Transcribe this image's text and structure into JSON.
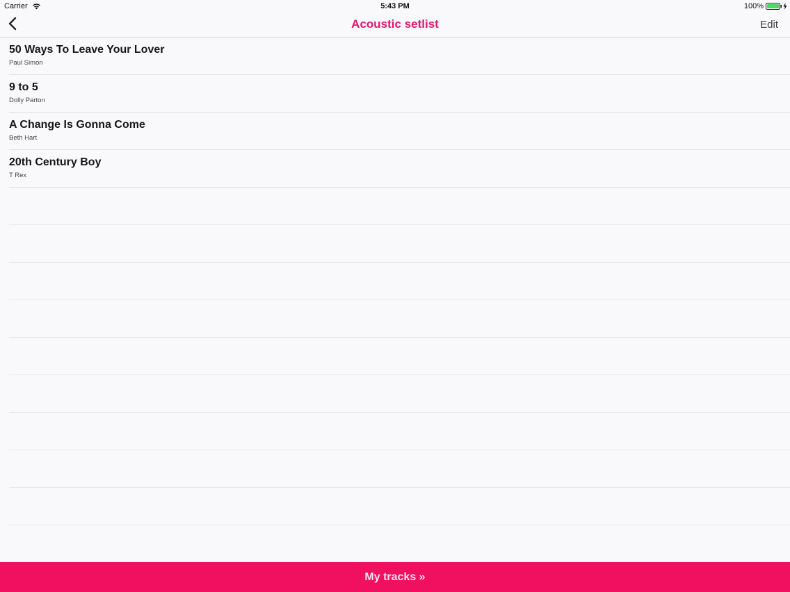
{
  "status_bar": {
    "carrier": "Carrier",
    "time": "5:43 PM",
    "battery": "100%"
  },
  "nav": {
    "title": "Acoustic setlist",
    "edit_label": "Edit",
    "back_icon": "chevron-left-icon"
  },
  "tracks": [
    {
      "title": "50 Ways To Leave Your Lover",
      "artist": "Paul Simon"
    },
    {
      "title": "9 to 5",
      "artist": "Dolly Parton"
    },
    {
      "title": "A Change Is Gonna Come",
      "artist": "Beth Hart"
    },
    {
      "title": "20th Century Boy",
      "artist": "T Rex"
    }
  ],
  "bottom_bar": {
    "label": "My tracks »"
  },
  "colors": {
    "accent": "#e3166a",
    "bottom_bar": "#f0105f",
    "battery": "#4cd964"
  }
}
